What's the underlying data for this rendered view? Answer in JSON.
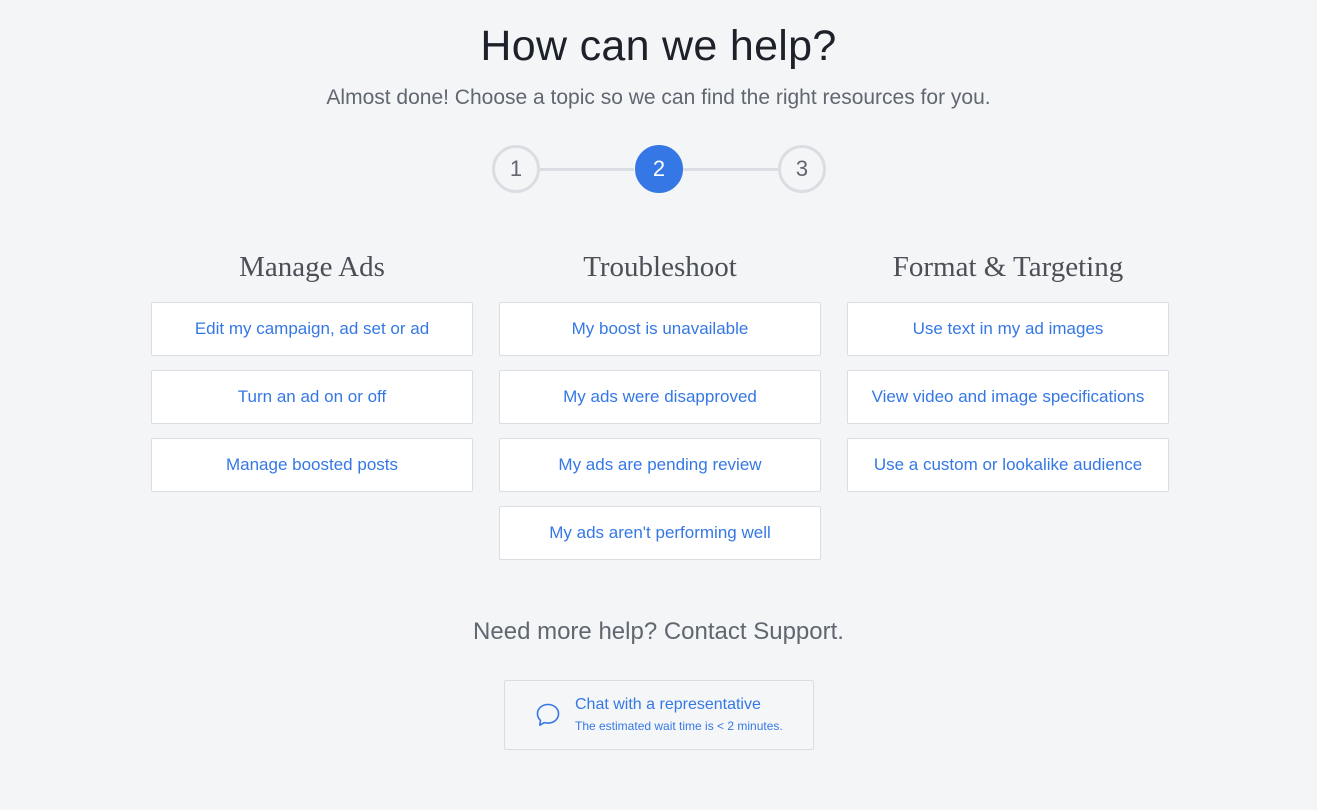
{
  "header": {
    "title": "How can we help?",
    "subtitle": "Almost done! Choose a topic so we can find the right resources for you."
  },
  "stepper": {
    "steps": [
      "1",
      "2",
      "3"
    ],
    "active_step": 2
  },
  "columns": [
    {
      "heading": "Manage Ads",
      "topics": [
        "Edit my campaign, ad set or ad",
        "Turn an ad on or off",
        "Manage boosted posts"
      ]
    },
    {
      "heading": "Troubleshoot",
      "topics": [
        "My boost is unavailable",
        "My ads were disapproved",
        "My ads are pending review",
        "My ads aren't performing well"
      ]
    },
    {
      "heading": "Format & Targeting",
      "topics": [
        "Use text in my ad images",
        "View video and image specifications",
        "Use a custom or lookalike audience"
      ]
    }
  ],
  "support": {
    "heading": "Need more help? Contact Support.",
    "chat_title": "Chat with a representative",
    "chat_subtitle": "The estimated wait time is < 2 minutes.",
    "chat_icon": "chat-bubble-icon"
  },
  "colors": {
    "accent": "#3578e5",
    "background": "#f4f5f7",
    "border": "#dadde1"
  }
}
